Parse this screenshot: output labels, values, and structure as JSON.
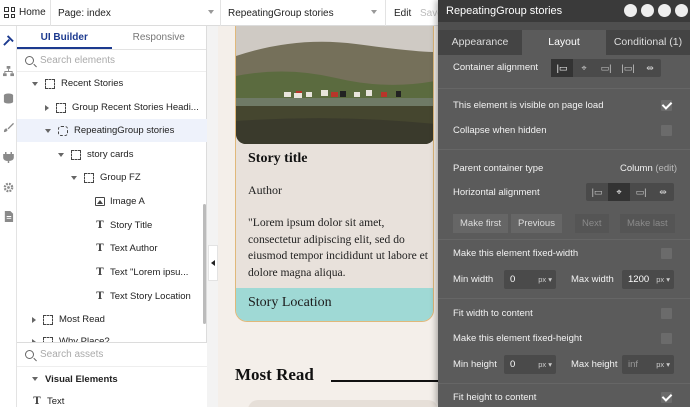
{
  "topbar": {
    "home_label": "Home",
    "page_label": "Page: index",
    "element_label": "RepeatingGroup stories",
    "edit_label": "Edit",
    "save_label": "Save"
  },
  "left_panel": {
    "tabs": [
      "UI Builder",
      "Responsive"
    ],
    "search_placeholder": "Search elements",
    "tree": [
      {
        "label": "Recent Stories",
        "icon": "group",
        "arrow": "down",
        "indent": 0
      },
      {
        "label": "Group Recent Stories Headi...",
        "icon": "group",
        "arrow": "right",
        "indent": 1
      },
      {
        "label": "RepeatingGroup stories",
        "icon": "repeating-group",
        "arrow": "down",
        "indent": 1,
        "selected": true
      },
      {
        "label": "story cards",
        "icon": "group",
        "arrow": "down",
        "indent": 2
      },
      {
        "label": "Group FZ",
        "icon": "group",
        "arrow": "down",
        "indent": 3
      },
      {
        "label": "Image A",
        "icon": "image",
        "arrow": "none",
        "indent": 4
      },
      {
        "label": "Story Title",
        "icon": "text",
        "arrow": "none",
        "indent": 4
      },
      {
        "label": "Text Author",
        "icon": "text",
        "arrow": "none",
        "indent": 4
      },
      {
        "label": "Text \"Lorem ipsu...",
        "icon": "text",
        "arrow": "none",
        "indent": 4
      },
      {
        "label": "Text Story Location",
        "icon": "text",
        "arrow": "none",
        "indent": 4
      },
      {
        "label": "Most Read",
        "icon": "group",
        "arrow": "right",
        "indent": 0
      },
      {
        "label": "Why Place?",
        "icon": "group",
        "arrow": "right",
        "indent": 0
      }
    ],
    "assets_placeholder": "Search assets",
    "visual_elements_label": "Visual Elements",
    "first_asset": "Text"
  },
  "canvas": {
    "card_title": "Story title",
    "card_author": "Author",
    "card_body": "\"Lorem ipsum dolor sit amet, consectetur adipiscing elit, sed do eiusmod tempor incididunt ut labore et dolore magna aliqua.",
    "card_location": "Story Location",
    "section_heading": "Most Read",
    "colors": {
      "card_bg": "#e8e1db",
      "location_bg": "#9fd9d5",
      "page_bg": "#f4efea"
    }
  },
  "property_editor": {
    "title": "RepeatingGroup stories",
    "tabs": [
      "Appearance",
      "Layout",
      "Conditional (1)"
    ],
    "active_tab": "Layout",
    "container_alignment_label": "Container alignment",
    "visible_on_load_label": "This element is visible on page load",
    "collapse_hidden_label": "Collapse when hidden",
    "parent_container_type_label": "Parent container type",
    "parent_container_type_value": "Column",
    "parent_container_edit": "(edit)",
    "horizontal_alignment_label": "Horizontal alignment",
    "buttons": [
      "Make first",
      "Previous",
      "Next",
      "Make last"
    ],
    "fixed_width_label": "Make this element fixed-width",
    "min_width_label": "Min width",
    "min_width_value": "0",
    "max_width_label": "Max width",
    "max_width_value": "1200",
    "unit": "px",
    "fit_width_label": "Fit width to content",
    "fixed_height_label": "Make this element fixed-height",
    "min_height_label": "Min height",
    "min_height_value": "0",
    "max_height_label": "Max height",
    "max_height_placeholder": "inf",
    "fit_height_label": "Fit height to content",
    "visible_on_load": true,
    "fit_height": true
  }
}
